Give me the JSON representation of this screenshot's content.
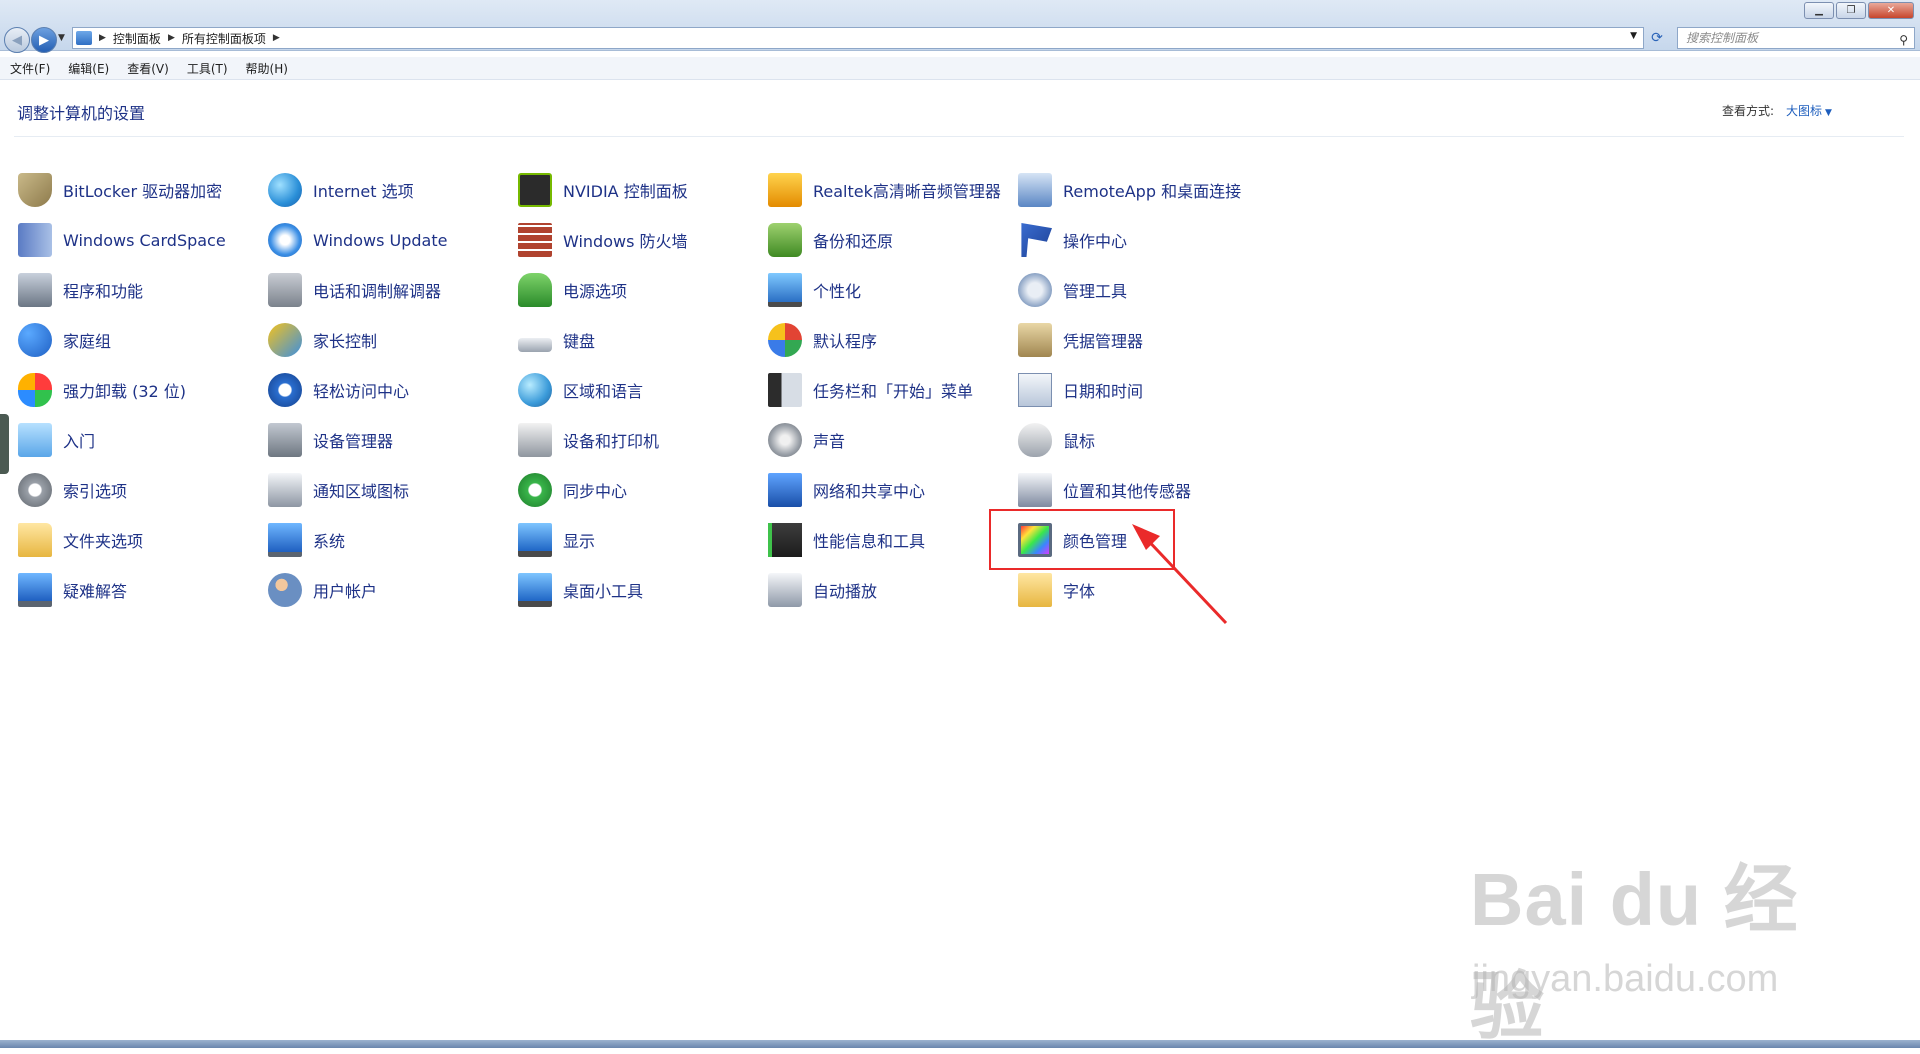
{
  "address": {
    "breadcrumbs": [
      "控制面板",
      "所有控制面板项"
    ],
    "search_placeholder": "搜索控制面板"
  },
  "menu": [
    "文件(F)",
    "编辑(E)",
    "查看(V)",
    "工具(T)",
    "帮助(H)"
  ],
  "header": {
    "title": "调整计算机的设置",
    "view_label": "查看方式:",
    "view_value": "大图标"
  },
  "items": [
    {
      "label": "BitLocker 驱动器加密",
      "icon": "shield-key-icon"
    },
    {
      "label": "Internet 选项",
      "icon": "internet-globe-icon"
    },
    {
      "label": "NVIDIA 控制面板",
      "icon": "nvidia-icon"
    },
    {
      "label": "Realtek高清晰音频管理器",
      "icon": "realtek-audio-icon"
    },
    {
      "label": "RemoteApp 和桌面连接",
      "icon": "remote-desktop-icon"
    },
    {
      "label": "Windows CardSpace",
      "icon": "cardspace-icon"
    },
    {
      "label": "Windows Update",
      "icon": "windows-update-icon"
    },
    {
      "label": "Windows 防火墙",
      "icon": "firewall-icon"
    },
    {
      "label": "备份和还原",
      "icon": "backup-icon"
    },
    {
      "label": "操作中心",
      "icon": "action-center-flag-icon"
    },
    {
      "label": "程序和功能",
      "icon": "programs-icon"
    },
    {
      "label": "电话和调制解调器",
      "icon": "phone-modem-icon"
    },
    {
      "label": "电源选项",
      "icon": "power-options-icon"
    },
    {
      "label": "个性化",
      "icon": "personalization-icon"
    },
    {
      "label": "管理工具",
      "icon": "admin-tools-icon"
    },
    {
      "label": "家庭组",
      "icon": "homegroup-icon"
    },
    {
      "label": "家长控制",
      "icon": "parental-controls-icon"
    },
    {
      "label": "键盘",
      "icon": "keyboard-icon"
    },
    {
      "label": "默认程序",
      "icon": "default-programs-icon"
    },
    {
      "label": "凭据管理器",
      "icon": "credential-manager-icon"
    },
    {
      "label": "强力卸载 (32 位)",
      "icon": "uninstaller-icon"
    },
    {
      "label": "轻松访问中心",
      "icon": "ease-of-access-icon"
    },
    {
      "label": "区域和语言",
      "icon": "region-language-icon"
    },
    {
      "label": "任务栏和「开始」菜单",
      "icon": "taskbar-start-icon"
    },
    {
      "label": "日期和时间",
      "icon": "date-time-icon"
    },
    {
      "label": "入门",
      "icon": "getting-started-icon"
    },
    {
      "label": "设备管理器",
      "icon": "device-manager-icon"
    },
    {
      "label": "设备和打印机",
      "icon": "devices-printers-icon"
    },
    {
      "label": "声音",
      "icon": "sound-icon"
    },
    {
      "label": "鼠标",
      "icon": "mouse-icon"
    },
    {
      "label": "索引选项",
      "icon": "indexing-icon"
    },
    {
      "label": "通知区域图标",
      "icon": "notification-icons-icon"
    },
    {
      "label": "同步中心",
      "icon": "sync-center-icon"
    },
    {
      "label": "网络和共享中心",
      "icon": "network-sharing-icon"
    },
    {
      "label": "位置和其他传感器",
      "icon": "location-sensors-icon"
    },
    {
      "label": "文件夹选项",
      "icon": "folder-options-icon"
    },
    {
      "label": "系统",
      "icon": "system-icon"
    },
    {
      "label": "显示",
      "icon": "display-icon"
    },
    {
      "label": "性能信息和工具",
      "icon": "performance-icon"
    },
    {
      "label": "颜色管理",
      "icon": "color-management-icon"
    },
    {
      "label": "疑难解答",
      "icon": "troubleshooting-icon"
    },
    {
      "label": "用户帐户",
      "icon": "user-accounts-icon"
    },
    {
      "label": "桌面小工具",
      "icon": "desktop-gadgets-icon"
    },
    {
      "label": "自动播放",
      "icon": "autoplay-icon"
    },
    {
      "label": "字体",
      "icon": "fonts-icon"
    }
  ],
  "annotation": {
    "highlight_color": "#ea2a2a",
    "highlighted_item": "颜色管理"
  },
  "watermark": {
    "logo": "Bai du 经验",
    "url": "jingyan.baidu.com"
  }
}
